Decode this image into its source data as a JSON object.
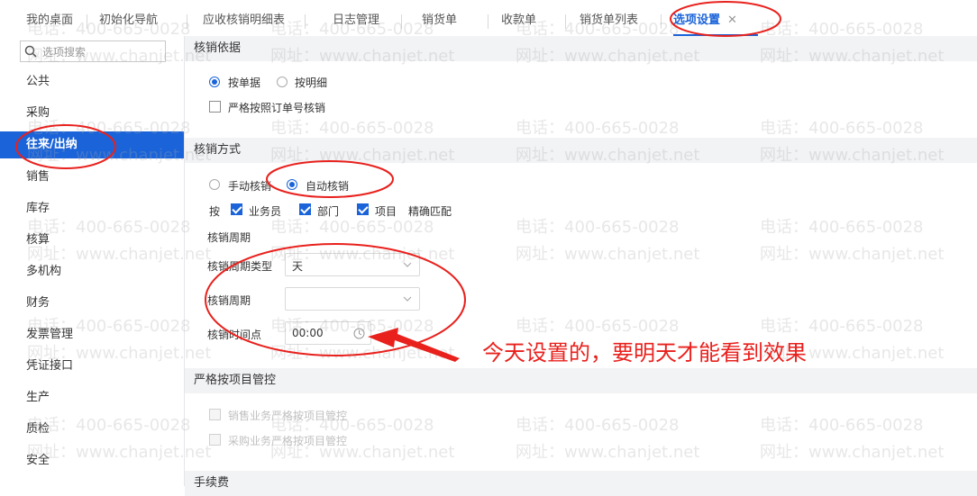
{
  "tabs": [
    {
      "label": "我的桌面"
    },
    {
      "label": "初始化导航"
    },
    {
      "label": "应收核销明细表"
    },
    {
      "label": "日志管理"
    },
    {
      "label": "销货单"
    },
    {
      "label": "收款单"
    },
    {
      "label": "销货单列表"
    },
    {
      "label": "选项设置",
      "close": "✕"
    }
  ],
  "sidebar": {
    "search_placeholder": "选项搜索",
    "items": [
      {
        "label": "公共"
      },
      {
        "label": "采购"
      },
      {
        "label": "往来/出纳"
      },
      {
        "label": "销售"
      },
      {
        "label": "库存"
      },
      {
        "label": "核算"
      },
      {
        "label": "多机构"
      },
      {
        "label": "财务"
      },
      {
        "label": "发票管理"
      },
      {
        "label": "凭证接口"
      },
      {
        "label": "生产"
      },
      {
        "label": "质检"
      },
      {
        "label": "安全"
      }
    ]
  },
  "basis": {
    "title": "核销依据",
    "by_doc": "按单据",
    "by_detail": "按明细",
    "strict_order": "严格按照订单号核销"
  },
  "method": {
    "title": "核销方式",
    "manual": "手动核销",
    "auto": "自动核销",
    "by_prefix": "按",
    "salesman": "业务员",
    "dept": "部门",
    "project": "项目",
    "exact_match": "精确匹配",
    "period_heading": "核销周期",
    "period_type_label": "核销周期类型",
    "period_type_value": "天",
    "period_label": "核销周期",
    "period_value": "",
    "time_label": "核销时间点",
    "time_value": "00:00"
  },
  "project_control": {
    "title": "严格按项目管控",
    "sales": "销售业务严格按项目管控",
    "purchase": "采购业务严格按项目管控"
  },
  "fee": {
    "title": "手续费"
  },
  "watermark": {
    "phone": "电话：400-665-0028",
    "site": "网址：www.chanjet.net"
  },
  "annotation": {
    "note": "今天设置的，要明天才能看到效果",
    "color": "#e8211d"
  },
  "colors": {
    "accent": "#1a63d8",
    "annotation": "#e8211d"
  }
}
